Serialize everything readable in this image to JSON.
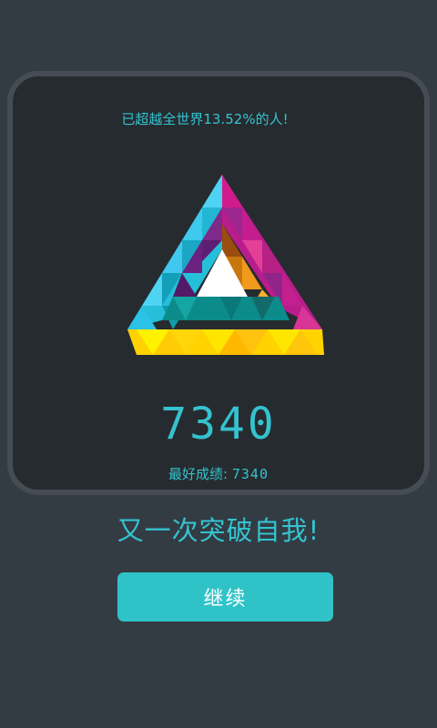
{
  "result": {
    "rank_text": "已超越全世界13.52%的人!",
    "score": "7340",
    "best_label": "最好成绩:",
    "best_value": "7340",
    "headline": "又一次突破自我!",
    "continue_label": "继续"
  },
  "colors": {
    "background": "#333b43",
    "card": "#262b2f",
    "card_border": "#454c53",
    "accent": "#34c3cf",
    "button": "#2fc3c8",
    "button_text": "#ffffff"
  },
  "logo": {
    "icon": "penrose-triangle-icon",
    "palette": [
      "#3ec9ef",
      "#19b2cc",
      "#c71c8f",
      "#8d2a8c",
      "#ffe600",
      "#ffc20e",
      "#f7a21b",
      "#9a4d0e",
      "#0a8a8a",
      "#ffffff"
    ]
  }
}
